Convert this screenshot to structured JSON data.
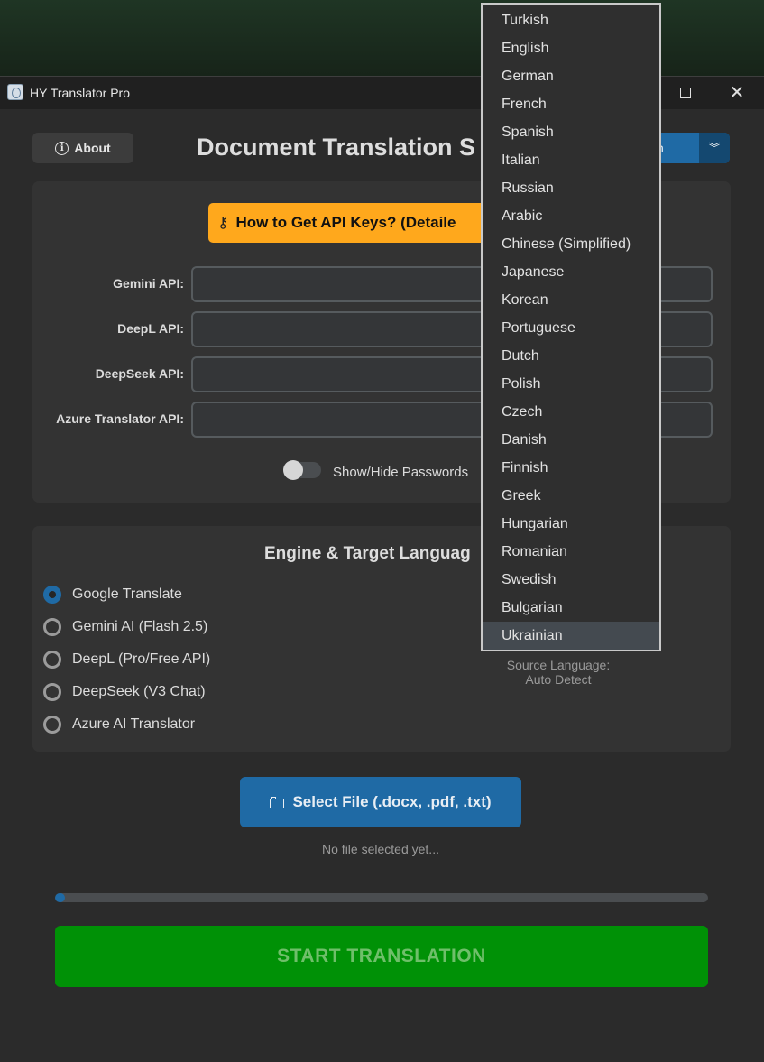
{
  "window": {
    "title": "HY Translator Pro"
  },
  "header": {
    "about_label": "About",
    "title": "Document Translation S",
    "language_combo_value": "h"
  },
  "api_panel": {
    "help_button_label": "How to Get API Keys? (Detaile",
    "fields": [
      {
        "label": "Gemini API:",
        "value": ""
      },
      {
        "label": "DeepL API:",
        "value": ""
      },
      {
        "label": "DeepSeek API:",
        "value": ""
      },
      {
        "label": "Azure Translator API:",
        "value": ""
      }
    ],
    "toggle_label": "Show/Hide Passwords",
    "toggle_on": false
  },
  "engine_panel": {
    "title": "Engine & Target Languag",
    "engines": [
      {
        "label": "Google Translate",
        "selected": true
      },
      {
        "label": "Gemini AI (Flash 2.5)",
        "selected": false
      },
      {
        "label": "DeepL (Pro/Free API)",
        "selected": false
      },
      {
        "label": "DeepSeek (V3 Chat)",
        "selected": false
      },
      {
        "label": "Azure AI Translator",
        "selected": false
      }
    ],
    "source_language_label": "Source Language:",
    "source_language_value": "Auto Detect"
  },
  "file": {
    "select_button_label": "Select File (.docx, .pdf, .txt)",
    "status": "No file selected yet..."
  },
  "progress": {
    "fraction": 0.015
  },
  "start_button_label": "START TRANSLATION",
  "language_dropdown": {
    "hovered": "Ukrainian",
    "options": [
      "Turkish",
      "English",
      "German",
      "French",
      "Spanish",
      "Italian",
      "Russian",
      "Arabic",
      "Chinese (Simplified)",
      "Japanese",
      "Korean",
      "Portuguese",
      "Dutch",
      "Polish",
      "Czech",
      "Danish",
      "Finnish",
      "Greek",
      "Hungarian",
      "Romanian",
      "Swedish",
      "Bulgarian",
      "Ukrainian"
    ]
  },
  "colors": {
    "accent_blue": "#1f6aa5",
    "warning_orange": "#ffa81c",
    "start_green": "#009106",
    "panel_bg": "#333333",
    "window_bg": "#2b2b2b"
  }
}
